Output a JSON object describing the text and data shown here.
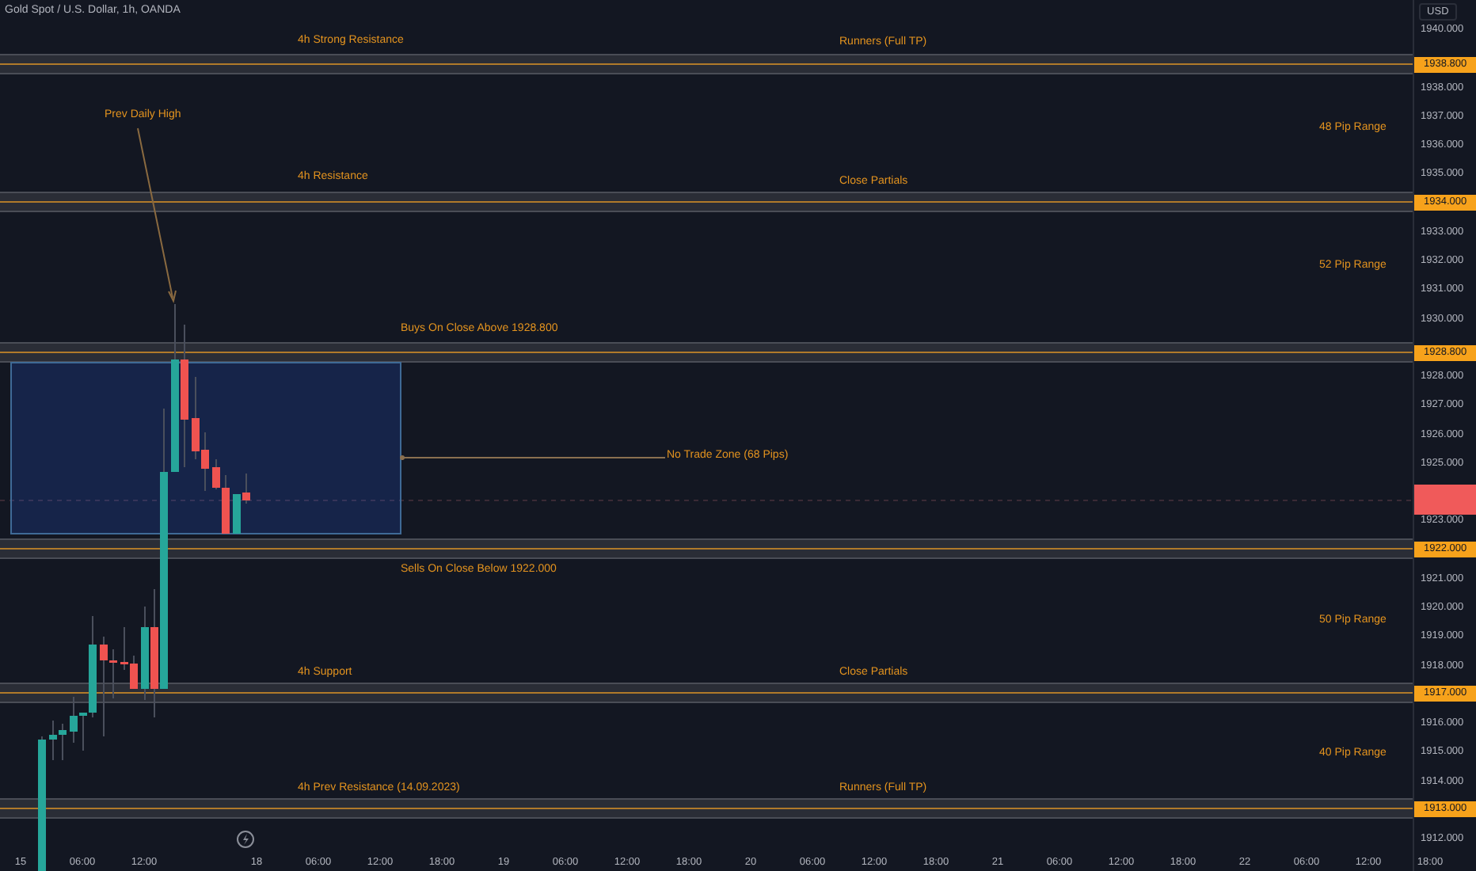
{
  "header": {
    "symbol": "Gold Spot / U.S. Dollar, 1h, OANDA"
  },
  "price_axis": {
    "currency": "USD",
    "ticks": [
      "1940.000",
      "1938.000",
      "1937.000",
      "1936.000",
      "1935.000",
      "1933.000",
      "1932.000",
      "1931.000",
      "1930.000",
      "1928.000",
      "1927.000",
      "1926.000",
      "1925.000",
      "1923.000",
      "1921.000",
      "1920.000",
      "1919.000",
      "1918.000",
      "1916.000",
      "1915.000",
      "1914.000",
      "1912.000"
    ],
    "level_labels": [
      "1938.800",
      "1934.000",
      "1928.800",
      "1922.000",
      "1917.000",
      "1913.000"
    ]
  },
  "time_axis": {
    "ticks": [
      "15",
      "06:00",
      "12:00",
      "18",
      "06:00",
      "12:00",
      "18:00",
      "19",
      "06:00",
      "12:00",
      "18:00",
      "20",
      "06:00",
      "12:00",
      "18:00",
      "21",
      "06:00",
      "12:00",
      "18:00",
      "22",
      "06:00",
      "12:00",
      "18:00"
    ]
  },
  "annotations": [
    {
      "text": "4h Strong Resistance"
    },
    {
      "text": "Runners (Full TP)"
    },
    {
      "text": "Prev Daily High"
    },
    {
      "text": "48 Pip Range"
    },
    {
      "text": "4h Resistance"
    },
    {
      "text": "Close Partials"
    },
    {
      "text": "52 Pip Range"
    },
    {
      "text": "Buys On Close Above 1928.800"
    },
    {
      "text": "No Trade Zone (68 Pips)"
    },
    {
      "text": "Sells On Close Below 1922.000"
    },
    {
      "text": "50 Pip Range"
    },
    {
      "text": "4h Support"
    },
    {
      "text": "Close Partials"
    },
    {
      "text": "40 Pip Range"
    },
    {
      "text": "4h Prev Resistance (14.09.2023)"
    },
    {
      "text": "Runners (Full TP)"
    }
  ]
}
